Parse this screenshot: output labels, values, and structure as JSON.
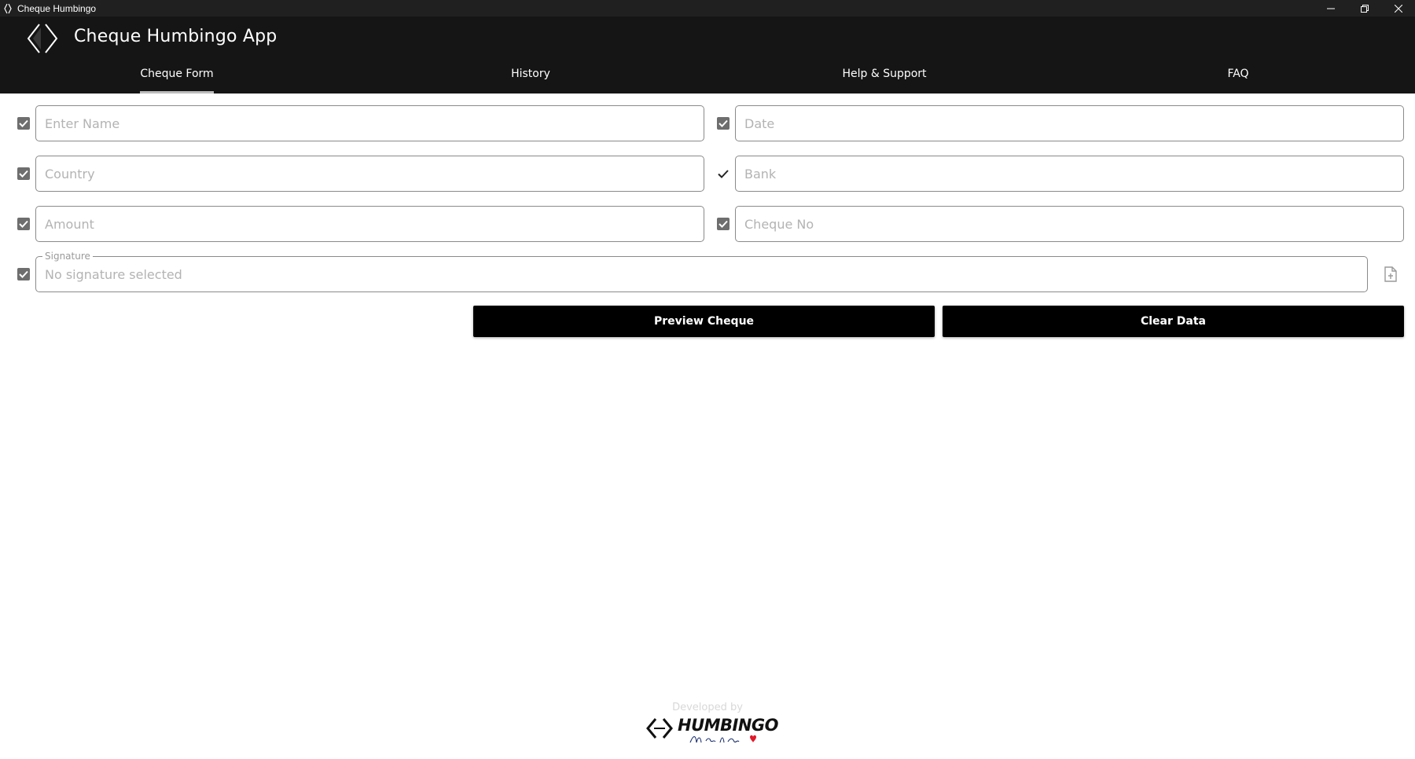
{
  "window": {
    "title": "Cheque Humbingo",
    "controls": [
      "minimize-icon",
      "restore-icon",
      "close-icon"
    ]
  },
  "header": {
    "app_title": "Cheque Humbingo App",
    "tabs": [
      {
        "label": "Cheque Form",
        "active": true
      },
      {
        "label": "History",
        "active": false
      },
      {
        "label": "Help & Support",
        "active": false
      },
      {
        "label": "FAQ",
        "active": false
      }
    ]
  },
  "form": {
    "name": {
      "placeholder": "Enter Name",
      "value": "",
      "checked": true
    },
    "date": {
      "placeholder": "Date",
      "value": "",
      "checked": true
    },
    "country": {
      "placeholder": "Country",
      "value": "",
      "checked": true
    },
    "bank": {
      "placeholder": "Bank",
      "value": "",
      "checked": true
    },
    "amount": {
      "placeholder": "Amount",
      "value": "",
      "checked": true
    },
    "cheque_no": {
      "placeholder": "Cheque No",
      "value": "",
      "checked": true
    },
    "signature": {
      "label": "Signature",
      "placeholder": "No signature selected",
      "value": "",
      "checked": true
    }
  },
  "actions": {
    "preview_label": "Preview Cheque",
    "clear_label": "Clear Data"
  },
  "footer": {
    "developed_by": "Developed by",
    "brand": "HUMBINGO",
    "tagline": "Made with Passion"
  },
  "colors": {
    "titlebar": "#202020",
    "header": "#151515",
    "button": "#000000",
    "accent_heart": "#e0192a"
  }
}
